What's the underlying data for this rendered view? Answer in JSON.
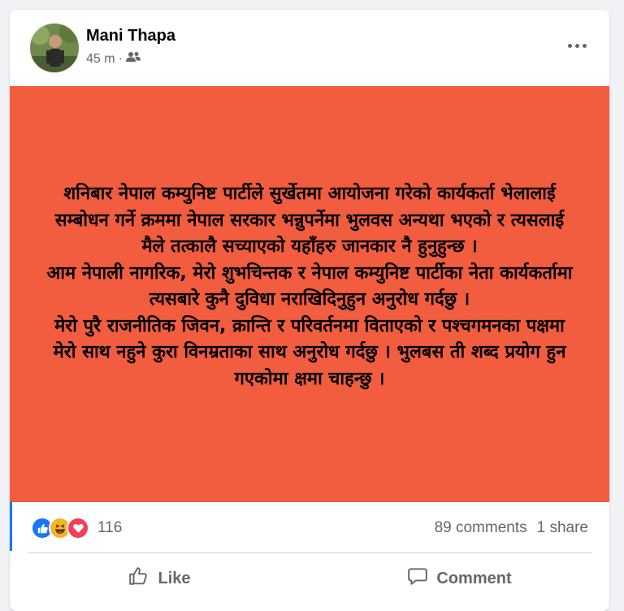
{
  "post": {
    "author": "Mani Thapa",
    "time": "45 m",
    "separator": "·",
    "audience_icon": "friends-icon",
    "body_lines": [
      "शनिबार नेपाल कम्युनिष्ट पार्टीले सुर्खेतमा आयोजना गरेको कार्यकर्ता भेलालाई सम्बोधन गर्ने क्रममा नेपाल सरकार भन्नुपर्नेमा भुलवस अन्यथा भएको र त्यसलाई मैले तत्कालै सच्याएको यहाँहरु जानकार नै हुनुहुन्छ ।",
      "आम नेपाली नागरिक, मेरो शुभचिन्तक र नेपाल कम्युनिष्ट पार्टीका नेता कार्यकर्तामा त्यसबारे कुनै दुविधा नराखिदिनुहुन अनुरोध गर्दछु ।",
      "मेरो पुरै राजनीतिक जिवन, क्रान्ति र परिवर्तनमा विताएको र पश्चगमनका पक्षमा मेरो साथ नहुने कुरा विनम्रताका साथ अनुरोध गर्दछु । भुलबस ती शब्द प्रयोग हुन गएकोमा क्षमा चाहन्छु ।"
    ],
    "background_color": "#f25c3f"
  },
  "stats": {
    "reaction_icons": [
      "like-icon",
      "haha-icon",
      "love-icon"
    ],
    "reaction_count": "116",
    "comments": "89 comments",
    "shares": "1 share"
  },
  "actions": {
    "like_label": "Like",
    "comment_label": "Comment"
  },
  "colors": {
    "like_blue": "#1877f2",
    "love_red": "#f33e58",
    "haha_yellow": "#f7b125",
    "muted_text": "#65676b"
  }
}
